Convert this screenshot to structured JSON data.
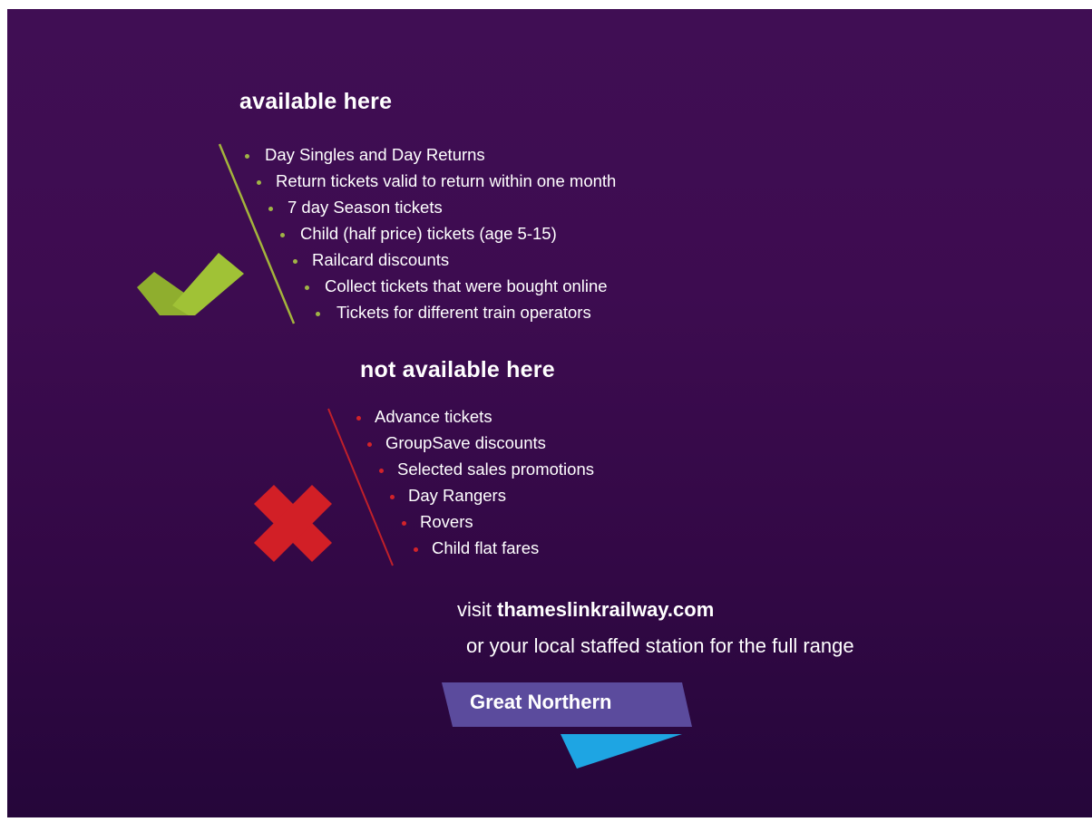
{
  "available": {
    "heading": "available here",
    "items": [
      "Day Singles and Day Returns",
      "Return tickets valid to return within one month",
      "7 day Season tickets",
      "Child (half price) tickets (age 5-15)",
      "Railcard discounts",
      "Collect tickets that were bought online",
      "Tickets for different train operators"
    ],
    "icon": "checkmark-icon",
    "accent_color": "#9ab93b"
  },
  "not_available": {
    "heading": "not available here",
    "items": [
      "Advance tickets",
      "GroupSave discounts",
      "Selected sales promotions",
      "Day Rangers",
      "Rovers",
      "Child flat fares"
    ],
    "icon": "cross-icon",
    "accent_color": "#d2232a"
  },
  "cta": {
    "prefix": "visit ",
    "site": "thameslinkrailway.com",
    "line2": "or your local staffed station for the full range"
  },
  "logo": {
    "text": "Great Northern",
    "colors": {
      "banner": "#5c4a9e",
      "arrow": "#1fa4e0"
    }
  },
  "background_color": "#3d0c50"
}
